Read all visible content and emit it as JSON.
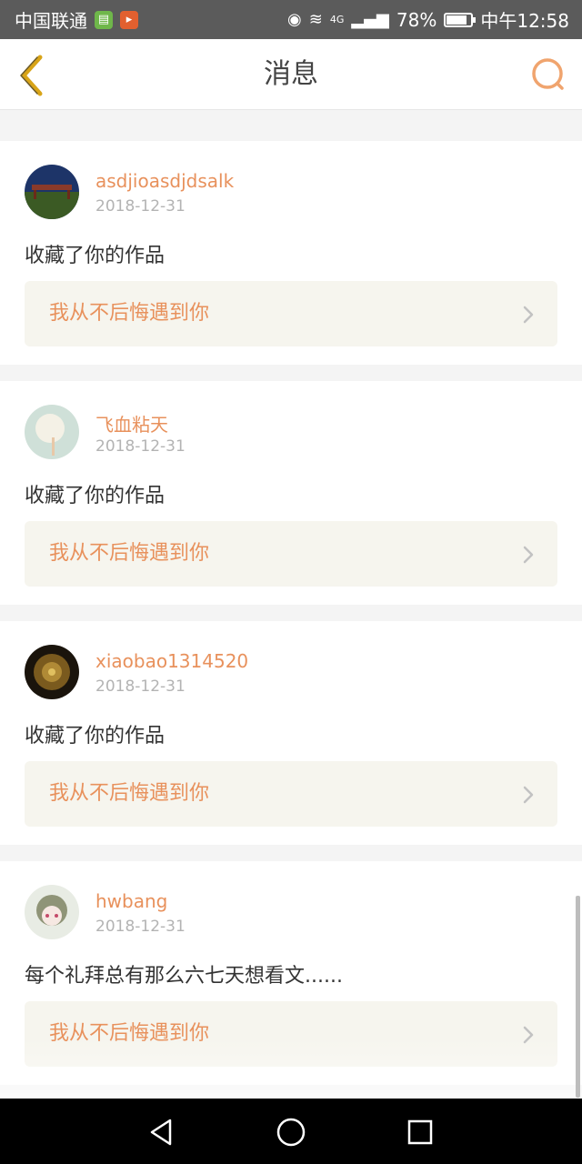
{
  "status_bar": {
    "carrier": "中国联通",
    "network": "4G",
    "battery": "78%",
    "time": "中午12:58"
  },
  "header": {
    "title": "消息"
  },
  "messages": [
    {
      "username": "asdjioasdjdsalk",
      "date": "2018-12-31",
      "action": "收藏了你的作品",
      "work_title": "我从不后悔遇到你"
    },
    {
      "username": "飞血粘天",
      "date": "2018-12-31",
      "action": "收藏了你的作品",
      "work_title": "我从不后悔遇到你"
    },
    {
      "username": "xiaobao1314520",
      "date": "2018-12-31",
      "action": "收藏了你的作品",
      "work_title": "我从不后悔遇到你"
    },
    {
      "username": "hwbang",
      "date": "2018-12-31",
      "action": "每个礼拜总有那么六七天想看文......",
      "work_title": "我从不后悔遇到你"
    }
  ],
  "colors": {
    "accent": "#e8915c",
    "back_icon": "#d8a418",
    "status_bar": "#5b5b5b",
    "link_bg": "#f6f5ee"
  },
  "icons": {
    "back": "chevron-left-icon",
    "search": "search-icon",
    "nav_back": "triangle-back-icon",
    "nav_home": "circle-home-icon",
    "nav_recents": "square-recents-icon"
  }
}
